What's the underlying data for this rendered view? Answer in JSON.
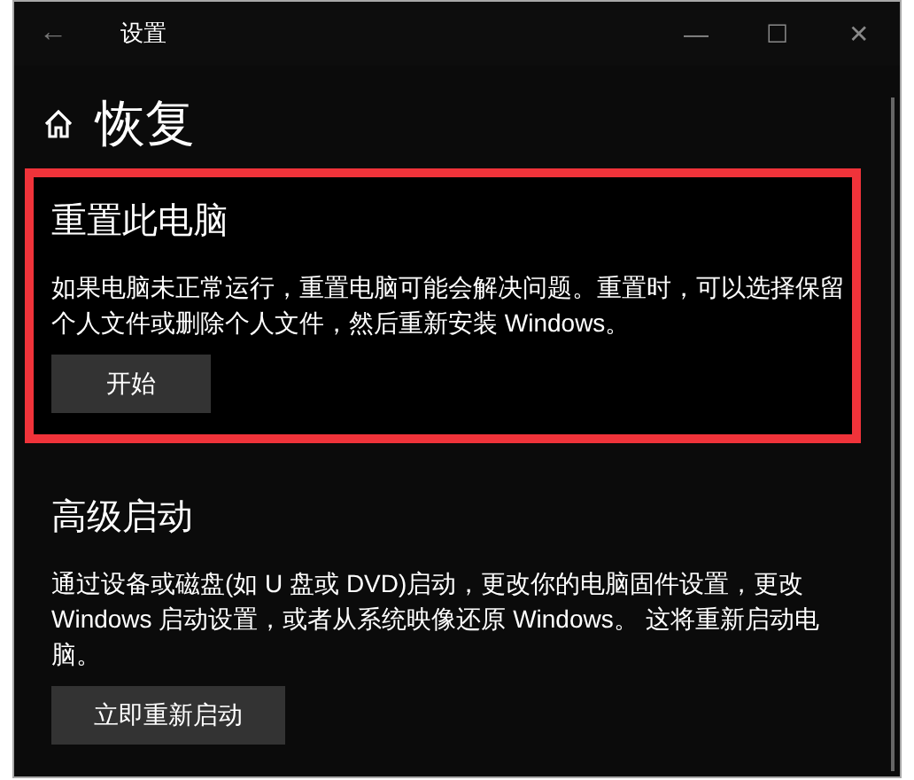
{
  "window": {
    "title": "设置",
    "back": "←",
    "minimize": "—",
    "maximize": "☐",
    "close": "✕"
  },
  "page": {
    "title": "恢复"
  },
  "sections": [
    {
      "title": "重置此电脑",
      "description": "如果电脑未正常运行，重置电脑可能会解决问题。重置时，可以选择保留个人文件或删除个人文件，然后重新安装 Windows。",
      "button": "开始",
      "highlighted": true
    },
    {
      "title": "高级启动",
      "description": "通过设备或磁盘(如 U 盘或 DVD)启动，更改你的电脑固件设置，更改 Windows 启动设置，或者从系统映像还原 Windows。 这将重新启动电脑。",
      "button": "立即重新启动",
      "highlighted": false
    }
  ]
}
